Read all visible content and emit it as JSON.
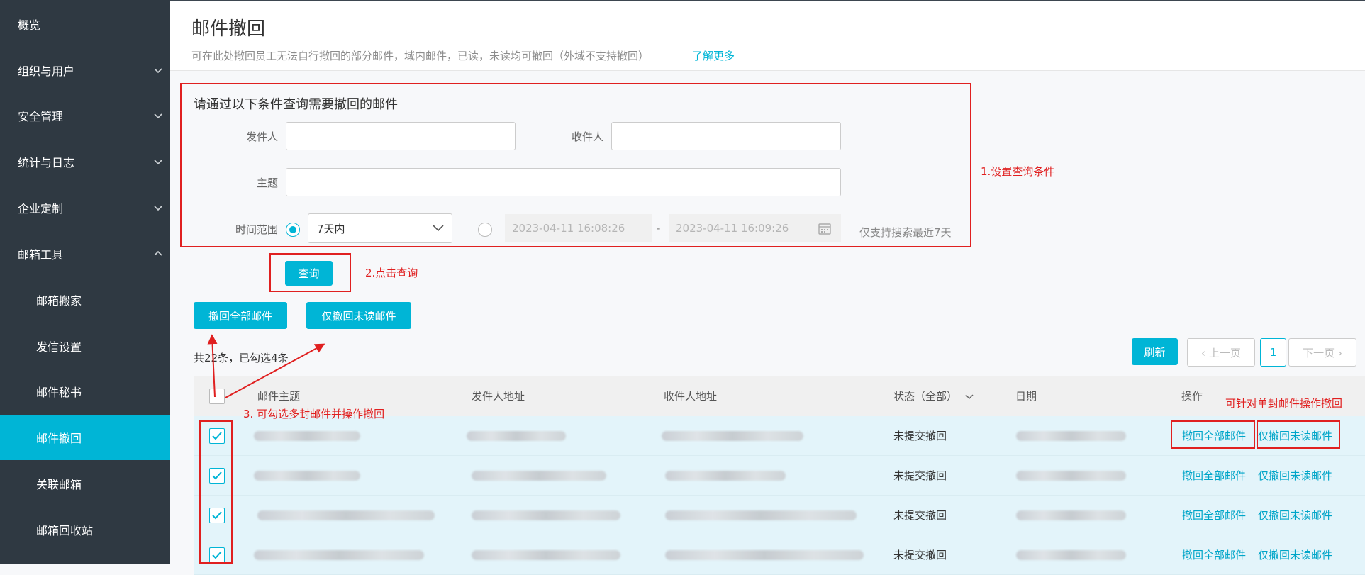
{
  "sidebar": {
    "items": [
      {
        "label": "概览"
      },
      {
        "label": "组织与用户"
      },
      {
        "label": "安全管理"
      },
      {
        "label": "统计与日志"
      },
      {
        "label": "企业定制"
      },
      {
        "label": "邮箱工具"
      }
    ],
    "subitems": [
      {
        "label": "邮箱搬家"
      },
      {
        "label": "发信设置"
      },
      {
        "label": "邮件秘书"
      },
      {
        "label": "邮件撤回"
      },
      {
        "label": "关联邮箱"
      },
      {
        "label": "邮箱回收站"
      }
    ],
    "active": "邮件撤回"
  },
  "header": {
    "title": "邮件撤回",
    "description": "可在此处撤回员工无法自行撤回的部分邮件，域内邮件，已读，未读均可撤回（外域不支持撤回）",
    "learn_more": "了解更多"
  },
  "query": {
    "heading": "请通过以下条件查询需要撤回的邮件",
    "sender_label": "发件人",
    "recipient_label": "收件人",
    "subject_label": "主题",
    "time_label": "时间范围",
    "time_option": "7天内",
    "date_start": "2023-04-11 16:08:26",
    "date_sep": "-",
    "date_end": "2023-04-11 16:09:26",
    "hint": "仅支持搜索最近7天",
    "search_button": "查询"
  },
  "actions": {
    "recall_all": "撤回全部邮件",
    "recall_unread": "仅撤回未读邮件",
    "refresh": "刷新",
    "prev_page": "‹ 上一页",
    "page": "1",
    "next_page": "下一页 ›",
    "count_text": "共22条，已勾选4条"
  },
  "table": {
    "columns": [
      "邮件主题",
      "发件人地址",
      "收件人地址",
      "状态（全部）",
      "日期",
      "操作"
    ],
    "rows": [
      {
        "status": "未提交撤回",
        "op_all": "撤回全部邮件",
        "op_unread": "仅撤回未读邮件",
        "checked": true
      },
      {
        "status": "未提交撤回",
        "op_all": "撤回全部邮件",
        "op_unread": "仅撤回未读邮件",
        "checked": true
      },
      {
        "status": "未提交撤回",
        "op_all": "撤回全部邮件",
        "op_unread": "仅撤回未读邮件",
        "checked": true
      },
      {
        "status": "未提交撤回",
        "op_all": "撤回全部邮件",
        "op_unread": "仅撤回未读邮件",
        "checked": true
      }
    ]
  },
  "annotations": {
    "a1": "1.设置查询条件",
    "a2": "2.点击查询",
    "a3": "3. 可勾选多封邮件并操作撤回",
    "a4": "可针对单封邮件操作撤回"
  },
  "colors": {
    "accent": "#00b5d6",
    "sidebar_bg": "#2f3942",
    "annotation": "#e02020",
    "row_bg": "#e3f4fa"
  }
}
